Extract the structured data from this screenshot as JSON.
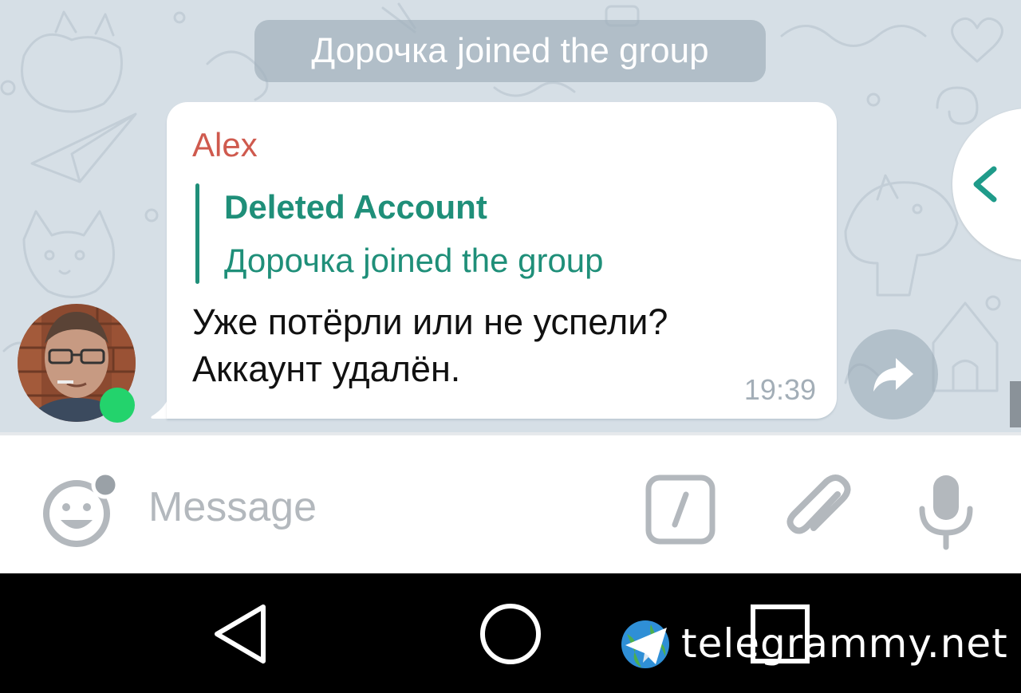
{
  "chat": {
    "service_message": "Дорочка joined the group",
    "message": {
      "sender": "Alex",
      "reply_author": "Deleted Account",
      "reply_text": "Дорочка joined the group",
      "text": "Уже потёрли или не успели?\nАккаунт удалён.",
      "time": "19:39",
      "sender_online": true
    },
    "share_icon": "forward-arrow-icon",
    "side_panel_icon": "chevron-left-icon"
  },
  "input_bar": {
    "placeholder": "Message",
    "emoji_icon": "smiley-icon",
    "commands_icon": "slash-command-icon",
    "attach_icon": "paperclip-icon",
    "mic_icon": "microphone-icon"
  },
  "nav_bar": {
    "back_icon": "triangle-back-icon",
    "home_icon": "circle-home-icon",
    "recents_icon": "square-recents-icon"
  },
  "watermark": {
    "text": "telegrammy.net",
    "icon": "globe-paper-plane-icon"
  },
  "colors": {
    "chat_background": "#d6dfe6",
    "sender_name": "#cf5a4e",
    "reply_accent": "#1f8f79",
    "online": "#23d36c",
    "icon_gray": "#b3b8bd"
  }
}
